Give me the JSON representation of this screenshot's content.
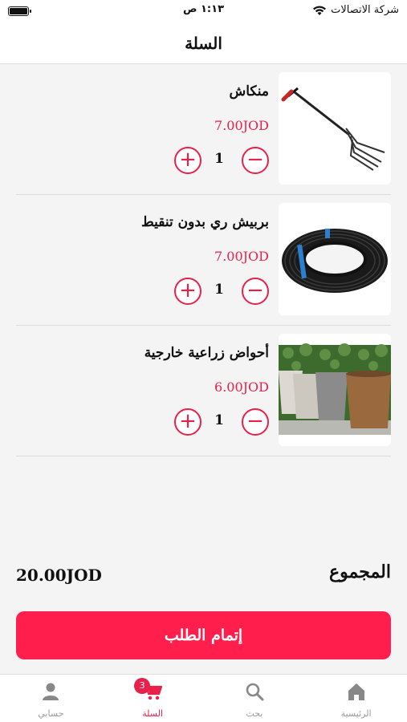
{
  "status_bar": {
    "carrier": "شركة الاتصالات",
    "time": "١:١٣ ص"
  },
  "nav": {
    "title": "السلة"
  },
  "cart": {
    "items": [
      {
        "name": "منكاش",
        "price": "7.00JOD",
        "quantity": "1",
        "image_icon": "garden-fork-image"
      },
      {
        "name": "بربيش ري بدون تنقيط",
        "price": "7.00JOD",
        "quantity": "1",
        "image_icon": "hose-coil-image"
      },
      {
        "name": "أحواض زراعية خارجية",
        "price": "6.00JOD",
        "quantity": "1",
        "image_icon": "planter-pots-image"
      }
    ],
    "plus_symbol": "+",
    "minus_symbol": "−"
  },
  "summary": {
    "total_label": "المجموع",
    "total_value": "20.00JOD"
  },
  "checkout": {
    "label": "إتمام الطلب"
  },
  "tab_bar": {
    "tabs": [
      {
        "label": "حسابي",
        "icon": "person-icon",
        "active": false
      },
      {
        "label": "السلة",
        "icon": "cart-icon",
        "active": true,
        "badge": "3"
      },
      {
        "label": "بحث",
        "icon": "search-icon",
        "active": false
      },
      {
        "label": "الرئيسية",
        "icon": "home-icon",
        "active": false
      }
    ]
  },
  "colors": {
    "accent": "#e8204a",
    "checkout_bg": "#ff1e4c",
    "background": "#f4f4f4"
  }
}
